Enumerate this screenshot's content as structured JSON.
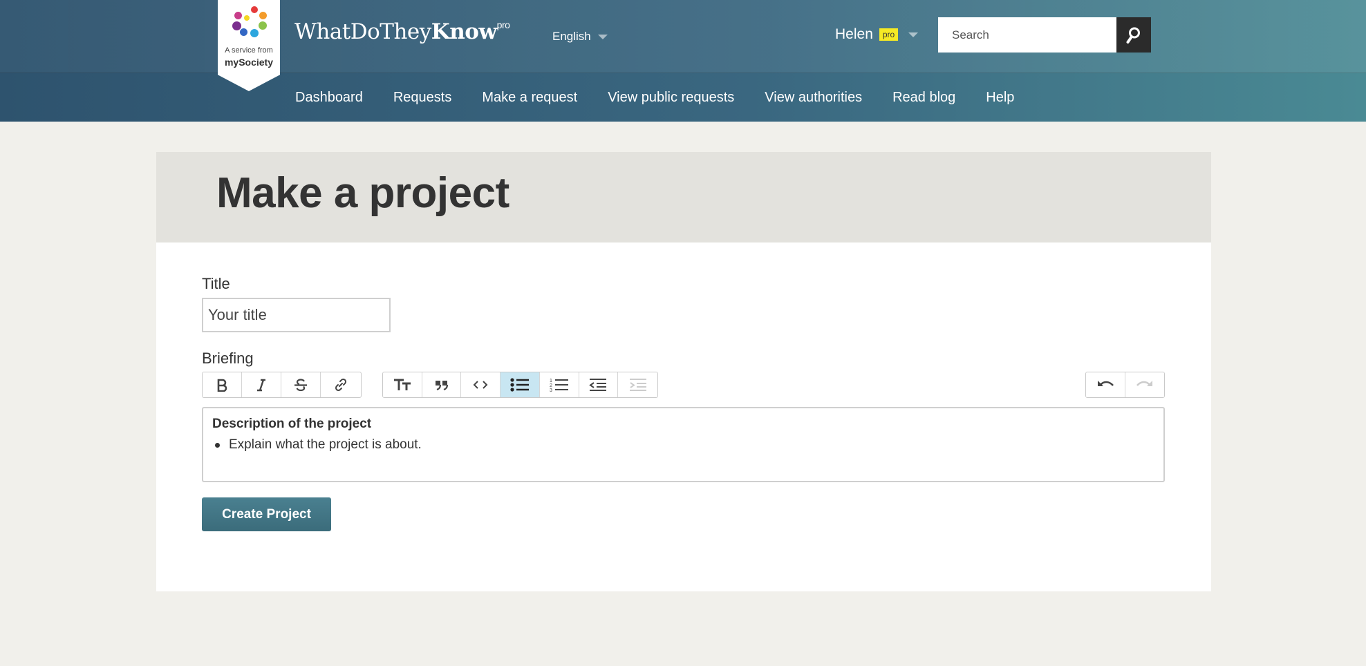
{
  "header": {
    "badge_line1": "A service from",
    "badge_line2": "mySociety",
    "logo_light": "WhatDoThey",
    "logo_bold": "Know",
    "logo_sup": "pro",
    "language": "English",
    "user_name": "Helen",
    "user_badge": "pro",
    "search_placeholder": "Search"
  },
  "nav": {
    "items": [
      "Dashboard",
      "Requests",
      "Make a request",
      "View public requests",
      "View authorities",
      "Read blog",
      "Help"
    ]
  },
  "main": {
    "page_title": "Make a project",
    "title_label": "Title",
    "title_placeholder": "Your title",
    "briefing_label": "Briefing",
    "toolbar": {
      "group1": [
        "bold-icon",
        "italic-icon",
        "strikethrough-icon",
        "link-icon"
      ],
      "group2": [
        "heading-icon",
        "quote-icon",
        "code-icon",
        "bullet-list-icon",
        "numbered-list-icon",
        "outdent-icon",
        "indent-icon"
      ],
      "group3": [
        "undo-icon",
        "redo-icon"
      ],
      "active": "bullet-list-icon"
    },
    "editor_heading": "Description of the project",
    "editor_bullet": "Explain what the project is about.",
    "submit_label": "Create Project"
  },
  "colors": {
    "accent": "#3f7281",
    "pro_badge": "#f6ea24",
    "active_tool": "#c8e6f2"
  }
}
